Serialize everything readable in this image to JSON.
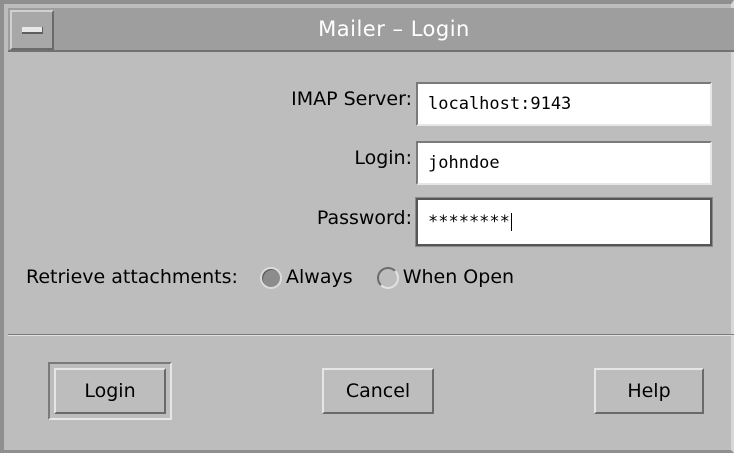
{
  "window": {
    "title": "Mailer – Login"
  },
  "form": {
    "imap_label": "IMAP Server:",
    "imap_value": "localhost:9143",
    "login_label": "Login:",
    "login_value": "johndoe",
    "password_label": "Password:",
    "password_value": "********"
  },
  "attachments": {
    "label": "Retrieve attachments:",
    "options": [
      {
        "label": "Always",
        "selected": true
      },
      {
        "label": "When Open",
        "selected": false
      }
    ]
  },
  "buttons": {
    "login": "Login",
    "cancel": "Cancel",
    "help": "Help"
  },
  "colors": {
    "window_bg": "#bdbdbd",
    "titlebar_bg": "#9e9e9e",
    "field_bg": "#ffffff"
  }
}
